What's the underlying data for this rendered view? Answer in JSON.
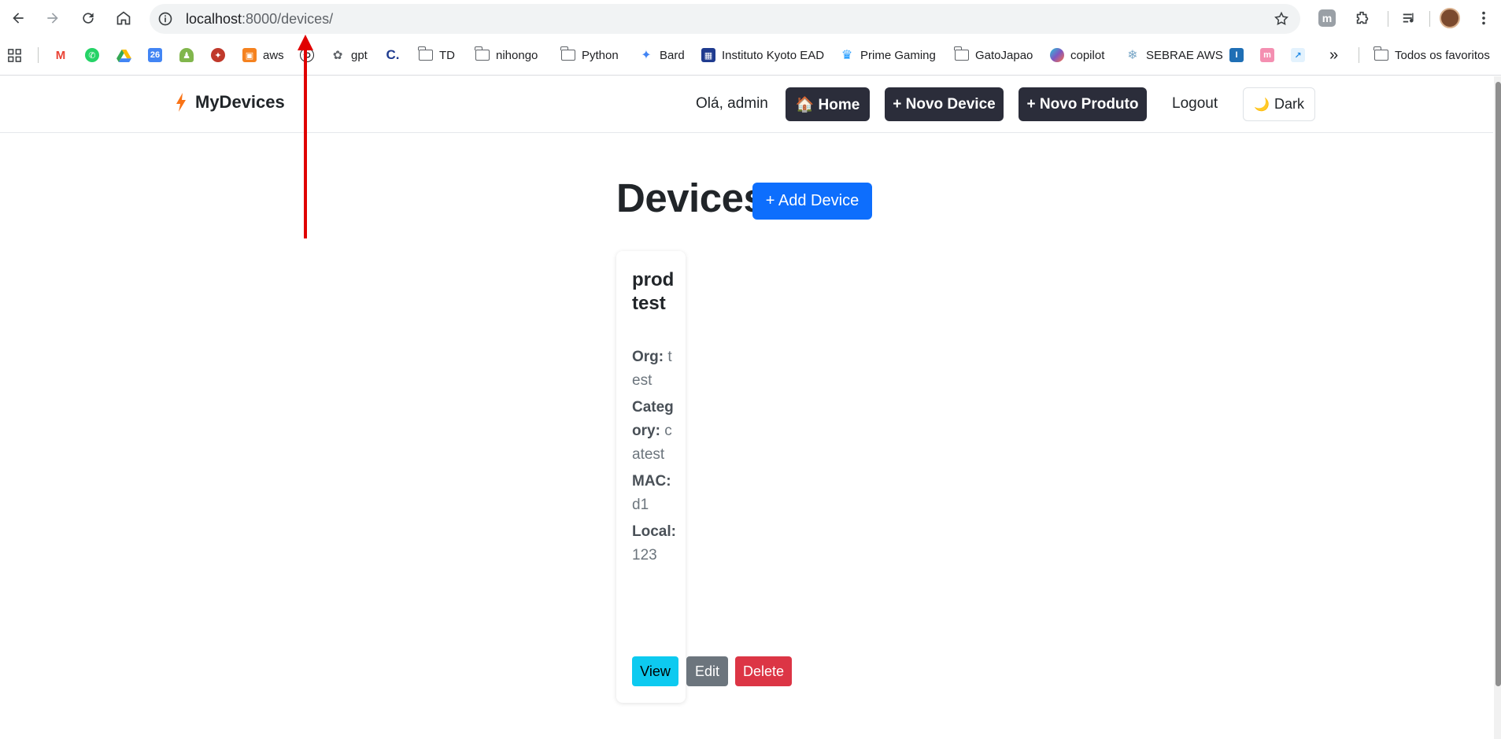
{
  "browser": {
    "url_host": "localhost",
    "url_rest": ":8000/devices/",
    "bookmarks": [
      {
        "label": "",
        "icon": "gmail-icon"
      },
      {
        "label": "",
        "icon": "whatsapp-icon"
      },
      {
        "label": "",
        "icon": "drive-icon"
      },
      {
        "label": "",
        "icon": "calendar-icon",
        "text": "26"
      },
      {
        "label": "",
        "icon": "chess-icon"
      },
      {
        "label": "",
        "icon": "game-icon"
      },
      {
        "label": "aws",
        "icon": "aws-icon"
      },
      {
        "label": "",
        "icon": "history-icon"
      },
      {
        "label": "gpt",
        "icon": "openai-icon"
      },
      {
        "label": "",
        "icon": "canva-icon"
      },
      {
        "label": "TD",
        "icon": "folder-icon"
      },
      {
        "label": "nihongo",
        "icon": "folder-icon"
      },
      {
        "label": "Python",
        "icon": "folder-icon"
      },
      {
        "label": "Bard",
        "icon": "sparkle-icon"
      },
      {
        "label": "Instituto Kyoto EAD",
        "icon": "kyoto-icon"
      },
      {
        "label": "Prime Gaming",
        "icon": "crown-icon"
      },
      {
        "label": "GatoJapao",
        "icon": "folder-icon"
      },
      {
        "label": "copilot",
        "icon": "copilot-icon"
      },
      {
        "label": "SEBRAE AWS",
        "icon": "gear-icon"
      },
      {
        "label": "",
        "icon": "info-icon"
      },
      {
        "label": "",
        "icon": "m-icon"
      },
      {
        "label": "",
        "icon": "chart-icon"
      }
    ],
    "all_bookmarks": "Todos os favoritos",
    "more": "»"
  },
  "navbar": {
    "brand": "MyDevices",
    "greeting": "Olá, admin",
    "home": "🏠 Home",
    "new_device": "+ Novo Device",
    "new_product": "+ Novo Produto",
    "logout": "Logout",
    "dark": "Dark",
    "dark_icon": "🌙"
  },
  "main": {
    "heading": "Devices",
    "add_button": "+ Add Device",
    "card": {
      "title": "prodtest",
      "org_label": "Org:",
      "org_value": "test",
      "category_label": "Category:",
      "category_value": "catest",
      "mac_label": "MAC:",
      "mac_value": "d1",
      "local_label": "Local:",
      "local_value": "123",
      "view": "View",
      "edit": "Edit",
      "delete": "Delete"
    }
  },
  "colors": {
    "primary": "#0d6efd",
    "dark": "#2b2d3a",
    "info": "#0dcaf0",
    "secondary": "#6c757d",
    "danger": "#dc3545",
    "annotation": "#e00000"
  }
}
